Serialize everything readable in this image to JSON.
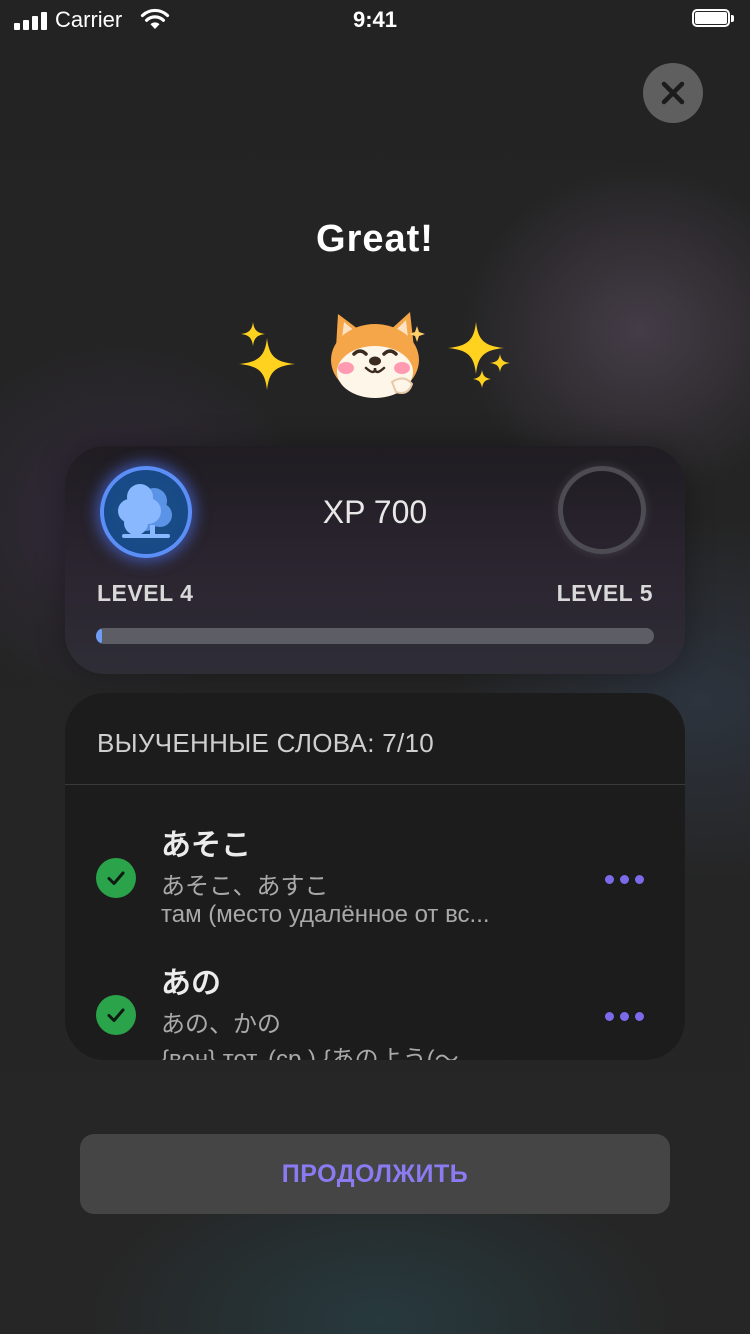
{
  "status_bar": {
    "carrier": "Carrier",
    "time": "9:41"
  },
  "title": "Great!",
  "level_card": {
    "xp_label": "XP 700",
    "current_level": "LEVEL 4",
    "next_level": "LEVEL 5",
    "progress_fraction": 0.01,
    "badge_icon": "tree-icon"
  },
  "words_card": {
    "header": "ВЫУЧЕННЫЕ СЛОВА: 7/10",
    "items": [
      {
        "title": "あそこ",
        "reading": "あそこ、あすこ",
        "definition": "там (место удалённое от вс..."
      },
      {
        "title": "あの",
        "reading": "あの、かの",
        "definition": "{вон} тот, (ср.) {あのよう(〜..."
      }
    ]
  },
  "continue_button": "ПРОДОЛЖИТЬ",
  "colors": {
    "accent_purple": "#7b6bea",
    "progress_blue": "#6f9cf4",
    "check_green": "#2aa34a",
    "badge_blue": "#184a87"
  }
}
